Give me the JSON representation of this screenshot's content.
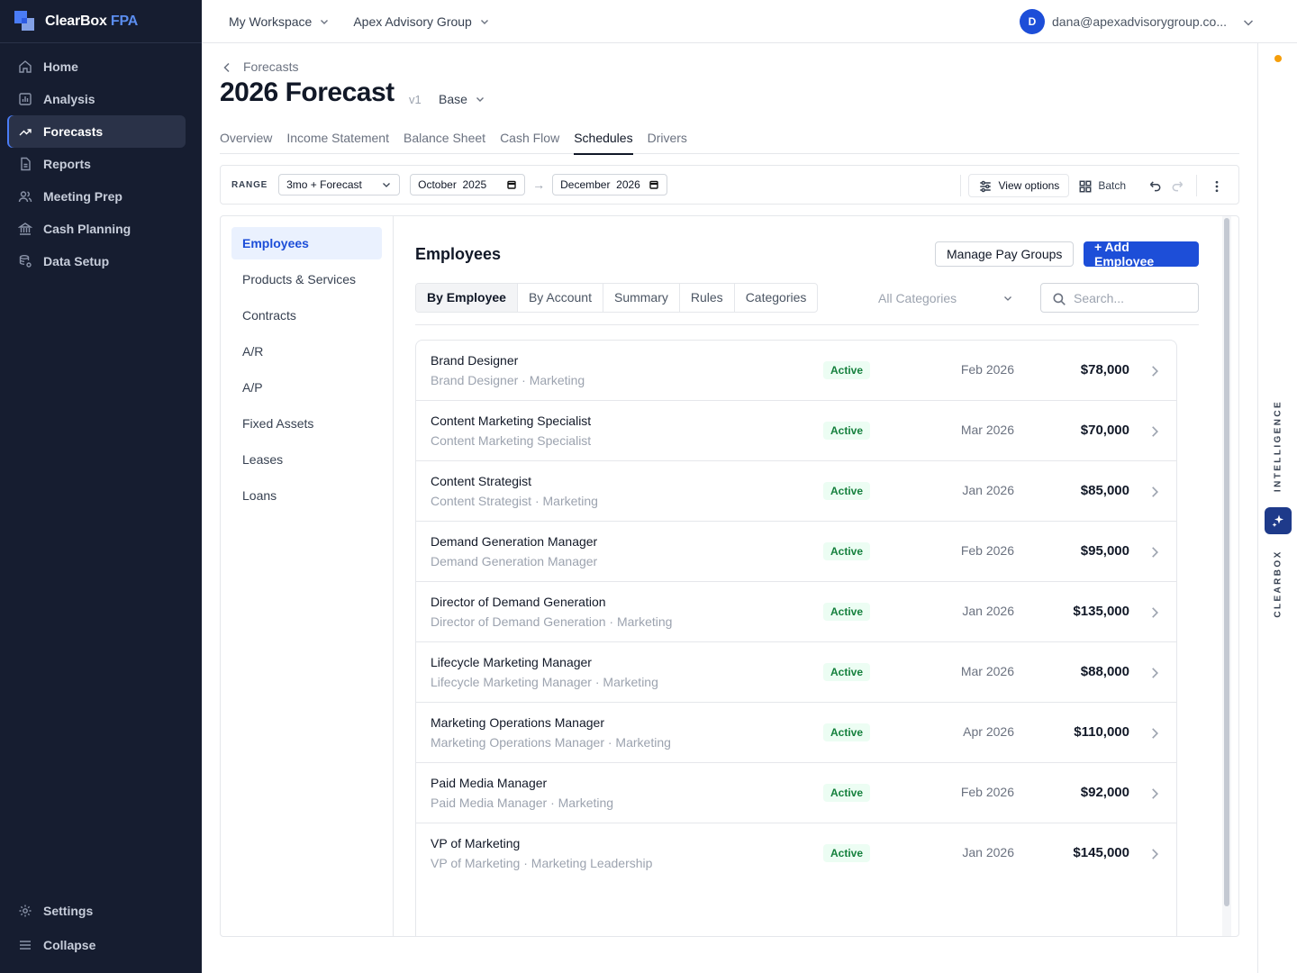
{
  "brand": {
    "name": "ClearBox",
    "suffix": "FPA"
  },
  "sidebar": {
    "items": [
      {
        "label": "Home",
        "icon": "home-icon"
      },
      {
        "label": "Analysis",
        "icon": "bar-chart-icon"
      },
      {
        "label": "Forecasts",
        "icon": "trending-up-icon",
        "active": true
      },
      {
        "label": "Reports",
        "icon": "document-icon"
      },
      {
        "label": "Meeting Prep",
        "icon": "users-icon"
      },
      {
        "label": "Cash Planning",
        "icon": "bank-icon"
      },
      {
        "label": "Data Setup",
        "icon": "database-icon"
      }
    ],
    "settings_label": "Settings",
    "collapse_label": "Collapse"
  },
  "topbar": {
    "workspace": "My Workspace",
    "company": "Apex Advisory Group",
    "user_initial": "D",
    "user_email": "dana@apexadvisorygroup.co..."
  },
  "page": {
    "breadcrumb": "Forecasts",
    "title": "2026 Forecast",
    "version": "v1",
    "scenario": "Base"
  },
  "tabs": [
    "Overview",
    "Income Statement",
    "Balance Sheet",
    "Cash Flow",
    "Schedules",
    "Drivers"
  ],
  "active_tab": "Schedules",
  "toolbar": {
    "range_label": "RANGE",
    "range_value": "3mo + Forecast",
    "start": "October  2025",
    "end": "December  2026",
    "view_options": "View options",
    "batch": "Batch"
  },
  "subnav": [
    "Employees",
    "Products & Services",
    "Contracts",
    "A/R",
    "A/P",
    "Fixed Assets",
    "Leases",
    "Loans"
  ],
  "content": {
    "title": "Employees",
    "manage_pay_groups": "Manage Pay Groups",
    "add_employee": "+ Add Employee",
    "segments": [
      "By Employee",
      "By Account",
      "Summary",
      "Rules",
      "Categories"
    ],
    "category_filter": "All Categories",
    "search_placeholder": "Search..."
  },
  "employees": [
    {
      "name": "Brand Designer",
      "sub": "Brand Designer · Marketing",
      "status": "Active",
      "start": "Feb 2026",
      "salary": "$78,000"
    },
    {
      "name": "Content Marketing Specialist",
      "sub": "Content Marketing Specialist",
      "status": "Active",
      "start": "Mar 2026",
      "salary": "$70,000"
    },
    {
      "name": "Content Strategist",
      "sub": "Content Strategist · Marketing",
      "status": "Active",
      "start": "Jan 2026",
      "salary": "$85,000"
    },
    {
      "name": "Demand Generation Manager",
      "sub": "Demand Generation Manager",
      "status": "Active",
      "start": "Feb 2026",
      "salary": "$95,000"
    },
    {
      "name": "Director of Demand Generation",
      "sub": "Director of Demand Generation · Marketing",
      "status": "Active",
      "start": "Jan 2026",
      "salary": "$135,000"
    },
    {
      "name": "Lifecycle Marketing Manager",
      "sub": "Lifecycle Marketing Manager · Marketing",
      "status": "Active",
      "start": "Mar 2026",
      "salary": "$88,000"
    },
    {
      "name": "Marketing Operations Manager",
      "sub": "Marketing Operations Manager · Marketing",
      "status": "Active",
      "start": "Apr 2026",
      "salary": "$110,000"
    },
    {
      "name": "Paid Media Manager",
      "sub": "Paid Media Manager · Marketing",
      "status": "Active",
      "start": "Feb 2026",
      "salary": "$92,000"
    },
    {
      "name": "VP of Marketing",
      "sub": "VP of Marketing · Marketing Leadership",
      "status": "Active",
      "start": "Jan 2026",
      "salary": "$145,000"
    }
  ],
  "rail": {
    "top_label": "INTELLIGENCE",
    "bottom_label": "CLEARBOX"
  },
  "colors": {
    "sidebar_bg": "#161d30",
    "accent": "#1d4ed8",
    "active_badge": "#15803d",
    "notification": "#f59e0b"
  }
}
